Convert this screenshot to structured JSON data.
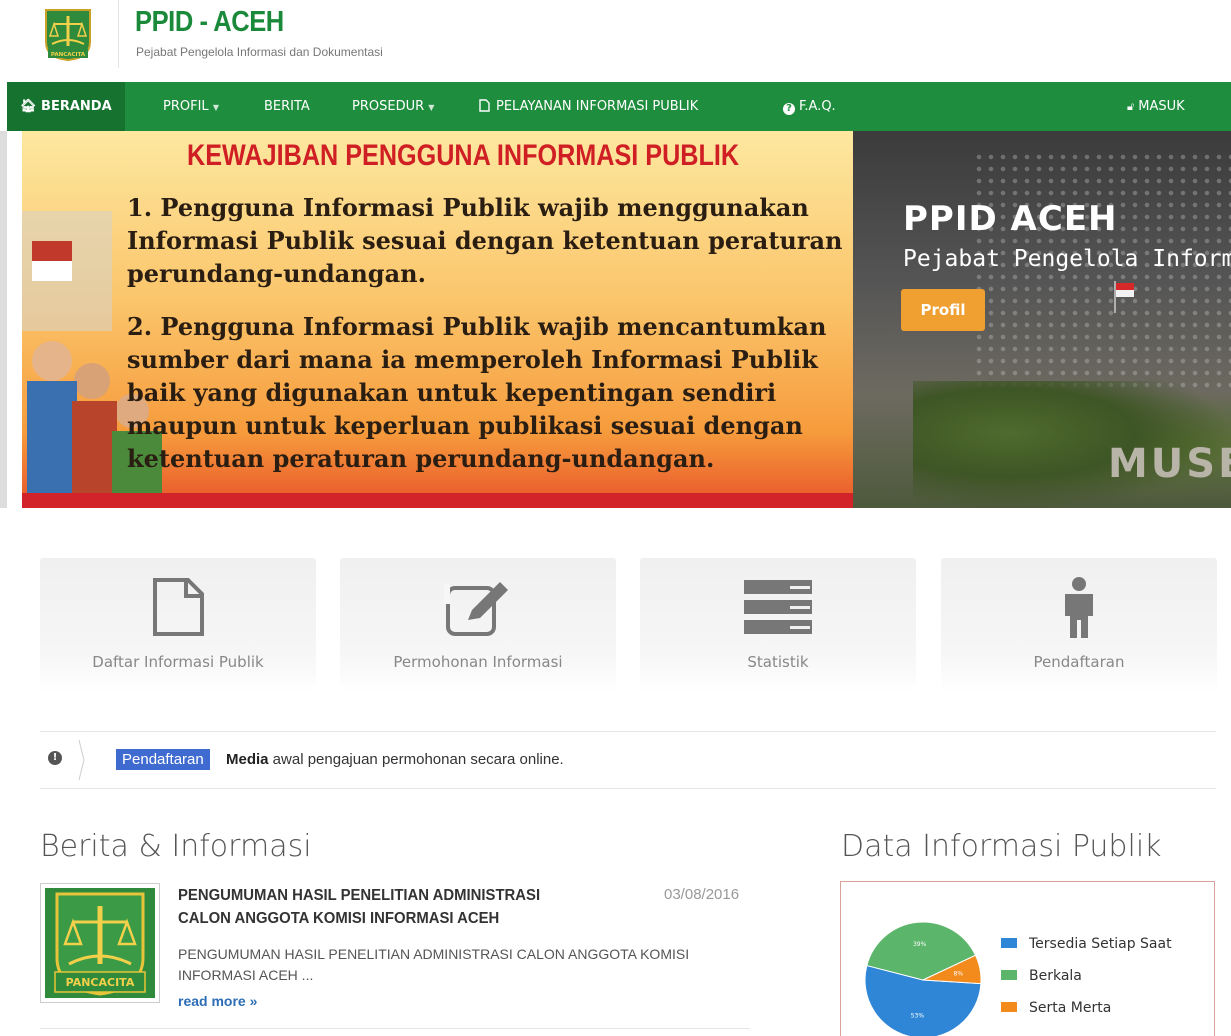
{
  "header": {
    "title": "PPID - ACEH",
    "subtitle": "Pejabat Pengelola Informasi dan Dokumentasi",
    "logo_text": "PANCACITA"
  },
  "nav": {
    "items": [
      {
        "label": "BERANDA",
        "icon": "home-icon"
      },
      {
        "label": "PROFIL",
        "dropdown": true
      },
      {
        "label": "BERITA"
      },
      {
        "label": "PROSEDUR",
        "dropdown": true
      },
      {
        "label": "PELAYANAN INFORMASI PUBLIK",
        "icon": "file-icon"
      },
      {
        "label": "F.A.Q.",
        "icon": "question-circle-icon"
      }
    ],
    "login": "MASUK",
    "caret": "▼"
  },
  "hero": {
    "banner_heading": "KEWAJIBAN PENGGUNA INFORMASI PUBLIK",
    "banner_point_1": "1. Pengguna Informasi Publik wajib menggunakan Informasi Publik sesuai dengan ketentuan peraturan perundang-undangan.",
    "banner_point_2": "2. Pengguna Informasi Publik wajib mencantumkan sumber dari mana ia memperoleh Informasi Publik baik yang digunakan untuk kepentingan sendiri maupun untuk keperluan publikasi sesuai dengan ketentuan peraturan perundang-undangan.",
    "caption_title": "PPID ACEH",
    "caption_subtitle": "Pejabat Pengelola Informa",
    "caption_button": "Profil",
    "building_sign": "MUSEU"
  },
  "features": [
    {
      "label": "Daftar Informasi Publik",
      "icon": "file-icon"
    },
    {
      "label": "Permohonan Informasi",
      "icon": "edit-icon"
    },
    {
      "label": "Statistik",
      "icon": "server-icon"
    },
    {
      "label": "Pendaftaran",
      "icon": "person-icon"
    }
  ],
  "ticker": {
    "icon": "info-icon",
    "badge": "Pendaftaran",
    "bold": "Media",
    "text": " awal pengajuan permohonan secara online."
  },
  "news": {
    "section_title": "Berita & Informasi",
    "items": [
      {
        "title": "PENGUMUMAN HASIL PENELITIAN ADMINISTRASI CALON ANGGOTA KOMISI INFORMASI ACEH",
        "date": "03/08/2016",
        "excerpt": "PENGUMUMAN HASIL PENELITIAN ADMINISTRASI CALON ANGGOTA KOMISI INFORMASI ACEH ...",
        "more": "read more »"
      }
    ]
  },
  "data_panel": {
    "section_title": "Data Informasi Publik"
  },
  "chart_data": {
    "type": "pie",
    "categories": [
      "Tersedia Setiap Saat",
      "Berkala",
      "Serta Merta"
    ],
    "values": [
      53,
      39,
      8
    ],
    "labels": [
      "53%",
      "39%",
      "8%"
    ],
    "colors": [
      "#2f86d6",
      "#5bb56a",
      "#f28a1c"
    ],
    "legend_position": "right"
  }
}
